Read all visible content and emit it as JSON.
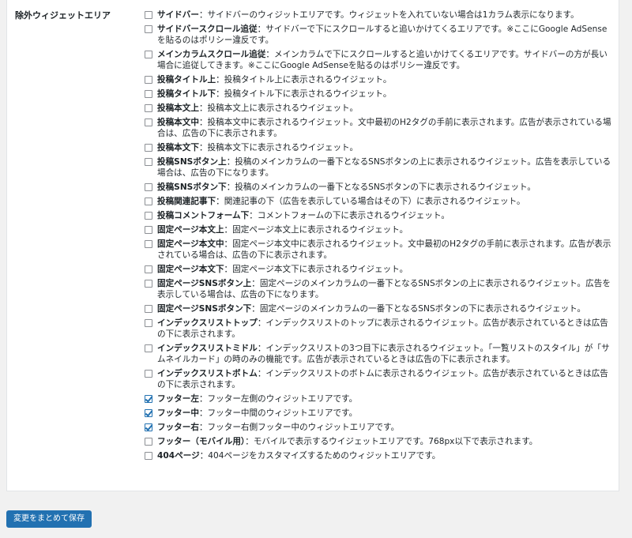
{
  "section": {
    "label": "除外ウィジェットエリア"
  },
  "options": [
    {
      "name": "サイドバー",
      "desc": "：サイドバーのウィジットエリアです。ウィジェットを入れていない場合は1カラム表示になります。",
      "checked": false
    },
    {
      "name": "サイドバースクロール追従",
      "desc": "：サイドバーで下にスクロールすると追いかけてくるエリアです。※ここにGoogle AdSenseを貼るのはポリシー違反です。",
      "checked": false
    },
    {
      "name": "メインカラムスクロール追従",
      "desc": "：メインカラムで下にスクロールすると追いかけてくるエリアです。サイドバーの方が長い場合に追従してきます。※ここにGoogle AdSenseを貼るのはポリシー違反です。",
      "checked": false
    },
    {
      "name": "投稿タイトル上",
      "desc": "：投稿タイトル上に表示されるウイジェット。",
      "checked": false
    },
    {
      "name": "投稿タイトル下",
      "desc": "：投稿タイトル下に表示されるウイジェット。",
      "checked": false
    },
    {
      "name": "投稿本文上",
      "desc": "：投稿本文上に表示されるウイジェット。",
      "checked": false
    },
    {
      "name": "投稿本文中",
      "desc": "：投稿本文中に表示されるウイジェット。文中最初のH2タグの手前に表示されます。広告が表示されている場合は、広告の下に表示されます。",
      "checked": false
    },
    {
      "name": "投稿本文下",
      "desc": "：投稿本文下に表示されるウイジェット。",
      "checked": false
    },
    {
      "name": "投稿SNSボタン上",
      "desc": "：投稿のメインカラムの一番下となるSNSボタンの上に表示されるウイジェット。広告を表示している場合は、広告の下になります。",
      "checked": false
    },
    {
      "name": "投稿SNSボタン下",
      "desc": "：投稿のメインカラムの一番下となるSNSボタンの下に表示されるウイジェット。",
      "checked": false
    },
    {
      "name": "投稿関連記事下",
      "desc": "：関連記事の下（広告を表示している場合はその下）に表示されるウイジェット。",
      "checked": false
    },
    {
      "name": "投稿コメントフォーム下",
      "desc": "：コメントフォームの下に表示されるウイジェット。",
      "checked": false
    },
    {
      "name": "固定ページ本文上",
      "desc": "：固定ページ本文上に表示されるウイジェット。",
      "checked": false
    },
    {
      "name": "固定ページ本文中",
      "desc": "：固定ページ本文中に表示されるウイジェット。文中最初のH2タグの手前に表示されます。広告が表示されている場合は、広告の下に表示されます。",
      "checked": false
    },
    {
      "name": "固定ページ本文下",
      "desc": "：固定ページ本文下に表示されるウイジェット。",
      "checked": false
    },
    {
      "name": "固定ページSNSボタン上",
      "desc": "：固定ページのメインカラムの一番下となるSNSボタンの上に表示されるウイジェット。広告を表示している場合は、広告の下になります。",
      "checked": false
    },
    {
      "name": "固定ページSNSボタン下",
      "desc": "：固定ページのメインカラムの一番下となるSNSボタンの下に表示されるウイジェット。",
      "checked": false
    },
    {
      "name": "インデックスリストトップ",
      "desc": "：インデックスリストのトップに表示されるウイジェット。広告が表示されているときは広告の下に表示されます。",
      "checked": false
    },
    {
      "name": "インデックスリストミドル",
      "desc": "：インデックスリストの3つ目下に表示されるウイジェット。「一覧リストのスタイル」が「サムネイルカード」の時のみの機能です。広告が表示されているときは広告の下に表示されます。",
      "checked": false
    },
    {
      "name": "インデックスリストボトム",
      "desc": "：インデックスリストのボトムに表示されるウイジェット。広告が表示されているときは広告の下に表示されます。",
      "checked": false
    },
    {
      "name": "フッター左",
      "desc": "：フッター左側のウィジットエリアです。",
      "checked": true
    },
    {
      "name": "フッター中",
      "desc": "：フッター中間のウィジットエリアです。",
      "checked": true
    },
    {
      "name": "フッター右",
      "desc": "：フッター右側フッター中のウィジットエリアです。",
      "checked": true
    },
    {
      "name": "フッター（モバイル用）",
      "desc": "：モバイルで表示するウイジェットエリアです。768px以下で表示されます。",
      "checked": false
    },
    {
      "name": "404ページ",
      "desc": "：404ページをカスタマイズするためのウィジットエリアです。",
      "checked": false
    }
  ],
  "footer": {
    "save_label": "変更をまとめて保存"
  },
  "colors": {
    "accent": "#2271b1",
    "background": "#f1f1f1",
    "panel": "#ffffff"
  }
}
